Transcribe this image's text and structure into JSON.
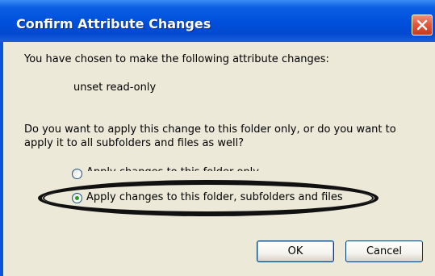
{
  "dialog": {
    "title": "Confirm Attribute Changes",
    "intro": "You have chosen to make the following attribute changes:",
    "change": "unset read-only",
    "question_line1": "Do you want to apply this change to this folder only, or do you want to",
    "question_line2": "apply it to all subfolders and files as well?",
    "options": [
      {
        "label": "Apply changes to this folder only",
        "selected": false
      },
      {
        "label": "Apply changes to this folder, subfolders and files",
        "selected": true
      }
    ],
    "ok_label": "OK",
    "cancel_label": "Cancel"
  },
  "colors": {
    "titlebar": "#0050dc",
    "body": "#ece9d8",
    "close": "#e25a3c",
    "radio_dot": "#21a121"
  },
  "icons": {
    "close": "close-icon"
  }
}
